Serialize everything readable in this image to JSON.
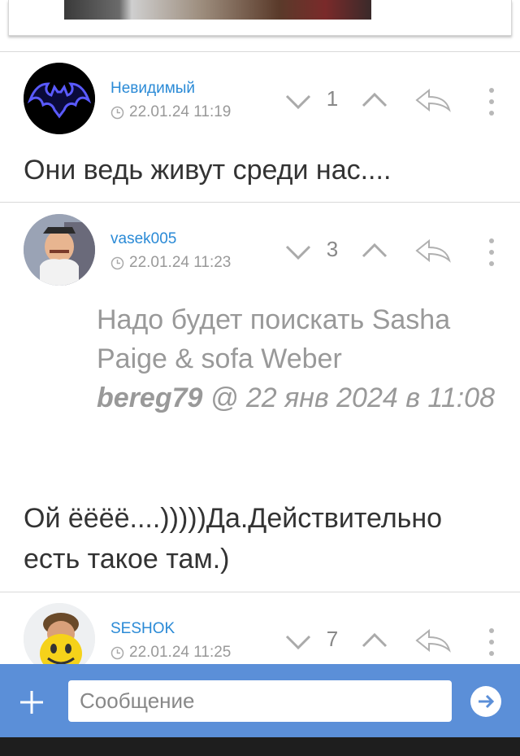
{
  "comments": [
    {
      "author": "Невидимый",
      "time": "22.01.24 11:19",
      "votes": "1",
      "avatar": "bat-logo-avatar",
      "text": "Они ведь живут среди нас...."
    },
    {
      "author": "vasek005",
      "time": "22.01.24 11:23",
      "votes": "3",
      "avatar": "cartoon-man-avatar",
      "quote": {
        "text": "Надо будет поискать Sasha Paige & sofa Weber",
        "user": "bereg79",
        "date": "@ 22 янв 2024 в 11:08"
      },
      "text_line1": "Ой ёёёё....)))))Да.Действительно",
      "text_line2": "есть такое там.)"
    },
    {
      "author": "SESHOK",
      "time": "22.01.24 11:25",
      "votes": "7",
      "avatar": "smiley-face-avatar"
    }
  ],
  "composer": {
    "placeholder": "Сообщение",
    "add_icon": "plus-icon",
    "send_icon": "send-arrow-icon"
  },
  "colors": {
    "link": "#2a8ad6",
    "composer_bar": "#5b8fd8",
    "muted": "#999999"
  }
}
